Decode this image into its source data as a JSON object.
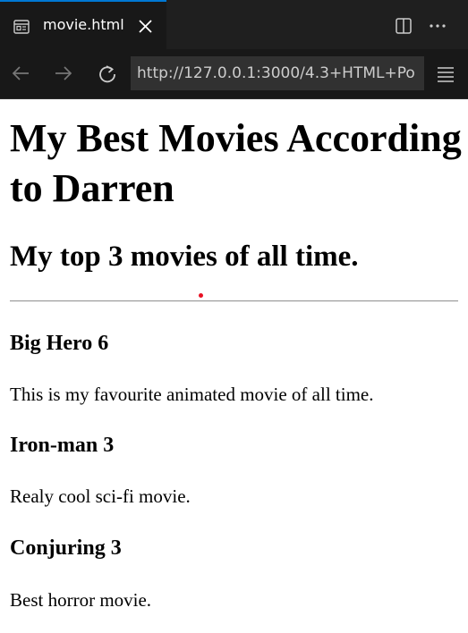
{
  "tab": {
    "title": "movie.html"
  },
  "toolbar": {
    "url": "http://127.0.0.1:3000/4.3+HTML+Po"
  },
  "page": {
    "heading": "My Best Movies According to Darren",
    "subheading": "My top 3 movies of all time.",
    "movies": [
      {
        "title": "Big Hero 6",
        "description": "This is my favourite animated movie of all time."
      },
      {
        "title": "Iron-man 3",
        "description": "Realy cool sci-fi movie."
      },
      {
        "title": "Conjuring 3",
        "description": "Best horror movie."
      }
    ]
  },
  "icons": {
    "file": "preview-file-icon",
    "close": "close-icon",
    "split": "split-editor-icon",
    "more": "more-actions-icon",
    "back": "back-arrow-icon",
    "forward": "forward-arrow-icon",
    "reload": "reload-icon",
    "menu": "hamburger-menu-icon"
  },
  "colors": {
    "tab_accent": "#0078d4",
    "chrome_bg": "#1f1f1f",
    "toolbar_bg": "#181818",
    "url_bg": "#313131",
    "cursor_dot": "#e81123"
  }
}
